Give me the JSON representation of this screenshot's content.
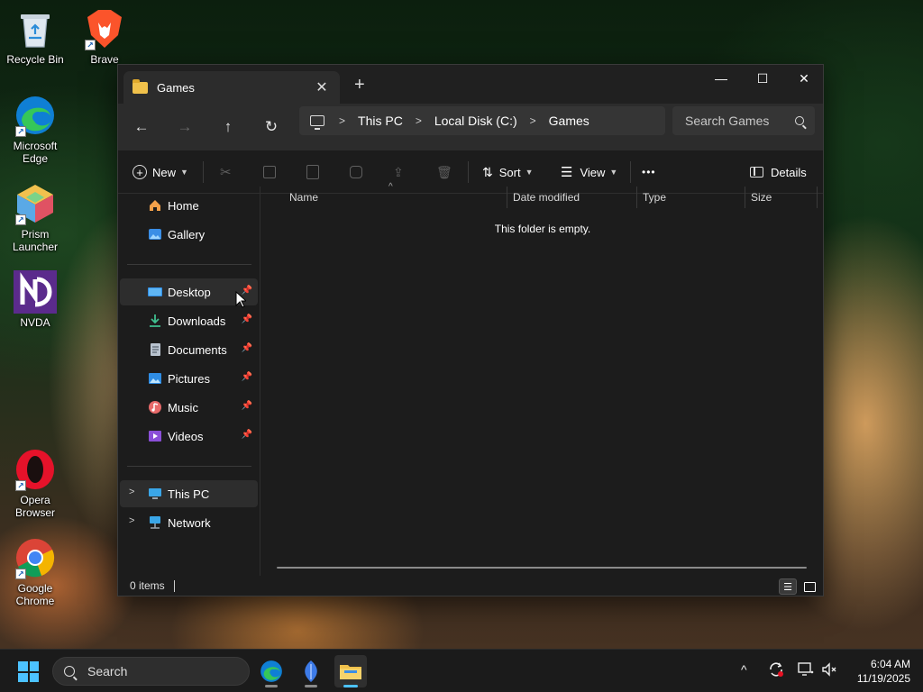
{
  "desktop": {
    "icons": [
      {
        "label": "Recycle Bin"
      },
      {
        "label": "Brave"
      },
      {
        "label_1": "Microsoft",
        "label_2": "Edge"
      },
      {
        "label_1": "Prism",
        "label_2": "Launcher"
      },
      {
        "label": "NVDA"
      },
      {
        "label_1": "Opera",
        "label_2": "Browser"
      },
      {
        "label_1": "Google",
        "label_2": "Chrome"
      }
    ]
  },
  "window": {
    "tab_title": "Games",
    "new_tab_label": "+",
    "controls": {
      "minimize": "—",
      "maximize": "☐",
      "close": "✕"
    },
    "nav": {
      "back": "←",
      "forward": "→",
      "up": "↑",
      "refresh": "↻"
    },
    "breadcrumb": [
      "This PC",
      "Local Disk (C:)",
      "Games"
    ],
    "search_placeholder": "Search Games",
    "toolbar": {
      "new_label": "New",
      "sort_label": "Sort",
      "view_label": "View",
      "more_label": "•••",
      "details_label": "Details"
    },
    "nav_pane": {
      "quick": [
        "Home",
        "Gallery"
      ],
      "pinned": [
        "Desktop",
        "Downloads",
        "Documents",
        "Pictures",
        "Music",
        "Videos"
      ],
      "devices": [
        "This PC",
        "Network"
      ]
    },
    "columns": [
      "Name",
      "Date modified",
      "Type",
      "Size"
    ],
    "empty_message": "This folder is empty.",
    "status": {
      "item_count": "0 items"
    }
  },
  "taskbar": {
    "search_label": "Search",
    "time": "6:04 AM",
    "date": "11/19/2025",
    "accent": "#4cc2ff"
  }
}
